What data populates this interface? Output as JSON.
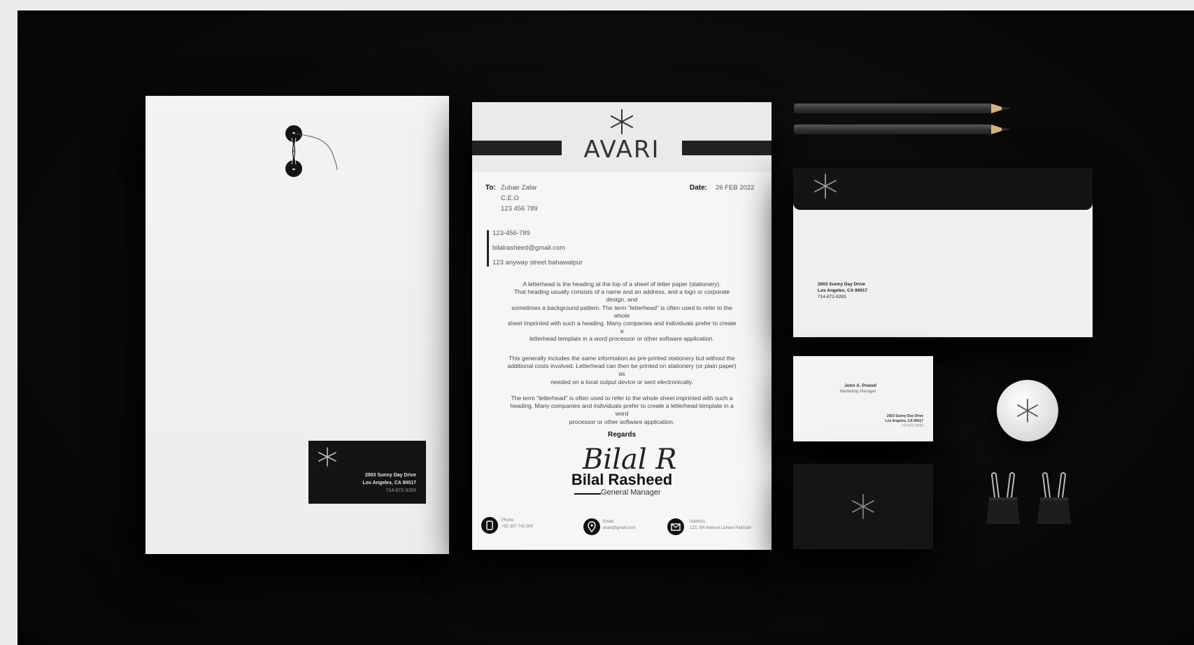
{
  "colors": {
    "background": "#0a0a0a",
    "paper": "#f6f6f6",
    "accent": "#141414"
  },
  "envelope": {
    "label_line1": "2003 Sunny Day Drive",
    "label_line2": "Los Angeles, CA 90017",
    "label_line3": "714-872-9283"
  },
  "letterhead": {
    "brand": "AVARI",
    "to_label": "To:",
    "to_name": "Zubair Zafar",
    "to_title": "C.E.O",
    "to_number": "123 456 789",
    "date_label": "Date:",
    "date_value": "26 FEB 2022",
    "phone": "123-456-789",
    "email": "bilalrasheed@gmail.com",
    "street": "123 anyway street bahawalpur",
    "p1_lines": [
      "A letterhead is the heading at the top of a sheet of letter paper (stationery).",
      "That heading usually consists of a name and an address, and a logo or corporate",
      "design, and",
      "sometimes a background pattern. The term \"letterhead\" is often used to refer to the",
      "whole",
      "sheet imprinted with such a heading. Many companies and individuals prefer to create",
      "a",
      "letterhead template in a word processor or other software application."
    ],
    "p2_lines": [
      "This generally includes the same information as pre-printed stationery but without the",
      "additional costs involved. Letterhead can then be printed on stationery (or plain paper)",
      "as",
      "needed on a local output device or sent electronically."
    ],
    "p3_lines": [
      "The term \"letterhead\" is often used to refer to the whole sheet imprinted with such a",
      "heading. Many companies and individuals prefer to create a letterhead template in a",
      "word",
      "processor or other software application."
    ],
    "regards": "Regards",
    "signature": "Bilal R",
    "signer_name": "Bilal Rasheed",
    "signer_role": "General Manager",
    "footer": {
      "phone_label": "Phone",
      "phone_value": "+92 307 741 000",
      "email_label": "Email",
      "email_value": "avari@gmail.com",
      "address_label": "Address",
      "address_value": "123, 5th Avenue Lahore Pakistan"
    }
  },
  "dl_envelope": {
    "addr_line1": "2003 Sunny Day Drive",
    "addr_line2": "Los Angeles, CA 90017",
    "addr_line3": "714-872-9283"
  },
  "business_card": {
    "name": "John A. Powell",
    "title": "Marketing Manager",
    "addr_line1": "2003 Sunny Day Drive",
    "addr_line2": "Los Angeles, CA 90017",
    "addr_line3": "714-872-9283"
  },
  "icons": [
    "asterisk-logo-icon",
    "button-clasp-icon",
    "phone-icon",
    "location-icon",
    "mail-icon",
    "binder-clip-icon",
    "pencil-icon"
  ]
}
